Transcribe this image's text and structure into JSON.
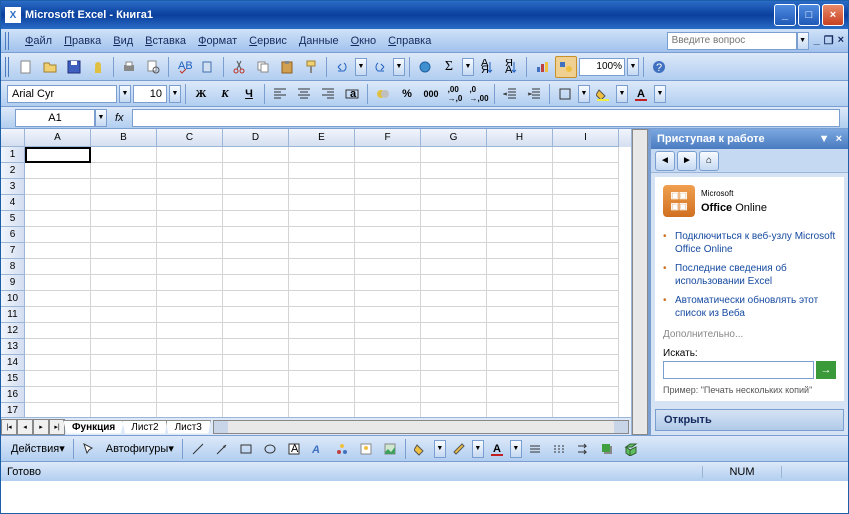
{
  "title": "Microsoft Excel - Книга1",
  "menus": [
    "Файл",
    "Правка",
    "Вид",
    "Вставка",
    "Формат",
    "Сервис",
    "Данные",
    "Окно",
    "Справка"
  ],
  "help_placeholder": "Введите вопрос",
  "zoom": "100%",
  "font": {
    "name": "Arial Cyr",
    "size": "10"
  },
  "name_box": "A1",
  "fx_label": "fx",
  "columns": [
    "A",
    "B",
    "C",
    "D",
    "E",
    "F",
    "G",
    "H",
    "I"
  ],
  "row_count": 18,
  "sheet_tabs": [
    "Функция",
    "Лист2",
    "Лист3"
  ],
  "task_pane": {
    "title": "Приступая к работе",
    "office_brand_pre": "Microsoft",
    "office_brand": "Office",
    "office_brand_suffix": " Online",
    "links": [
      "Подключиться к веб-узлу Microsoft Office Online",
      "Последние сведения об использовании Excel",
      "Автоматически обновлять этот список из Веба"
    ],
    "more": "Дополнительно...",
    "search_label": "Искать:",
    "example": "Пример: \"Печать нескольких копий\"",
    "open": "Открыть"
  },
  "draw": {
    "actions": "Действия",
    "autoshapes": "Автофигуры"
  },
  "status": {
    "ready": "Готово",
    "num": "NUM"
  }
}
